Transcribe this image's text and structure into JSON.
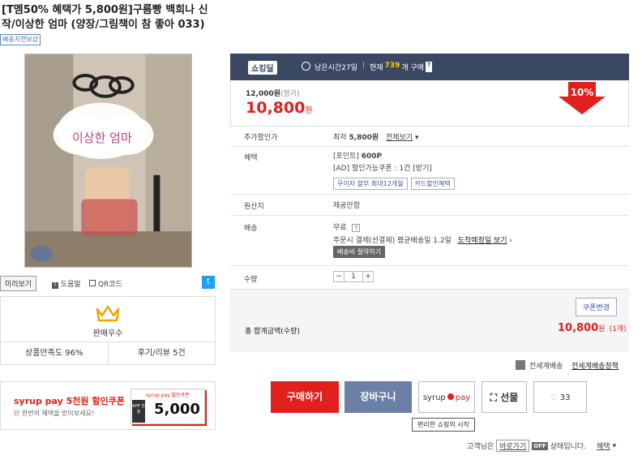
{
  "product": {
    "title": "[T멤50% 혜택가 5,800원]구름빵 백희나 신작/이상한 엄마 (양장/그림책이 참 좋아 033)",
    "badge": "배송지연보상",
    "photo_caption": "이상한 엄마"
  },
  "left_panel": {
    "preview_label": "미리보기",
    "help_label": "도움말",
    "qr_label": "QR코드",
    "seller_grade": "판매우수",
    "satisfaction": "상품만족도 96%",
    "reviews": "후기/리뷰 5건"
  },
  "ad": {
    "headline": "syrup pay 5천원 할인쿠폰",
    "sub": "단 한번의 혜택을 받아보세요!",
    "card_brand": "syrup pay 할인쿠폰",
    "card_app": "APP 전용",
    "card_amount": "5,000"
  },
  "deal_header": {
    "logo": "쇼킹딜",
    "remaining": "남은시간27일",
    "sep": "|",
    "current_prefix": "현재",
    "count": "739",
    "current_suffix": "개 구매",
    "help": "?"
  },
  "price": {
    "original": "12,000원",
    "original_tag": "(정가)",
    "sale": "10,800",
    "won": "원",
    "discount": "10%"
  },
  "rows": {
    "extra_discount": {
      "label": "추가할인가",
      "prefix": "최저",
      "amount": "5,800원",
      "link": "전체보기"
    },
    "benefit": {
      "label": "혜택",
      "point": "[포인트]",
      "point_val": "600P",
      "coupon": "[AD] 할인가능쿠폰 : 1건 [받기]",
      "installment_btn": "무이자 할부 최대12개월",
      "card_btn": "카드할인혜택"
    },
    "origin": {
      "label": "원산지",
      "value": "제공안함"
    },
    "shipping": {
      "label": "배송",
      "free": "무료",
      "help": "?",
      "detail": "주문시 결제(선결제) 평균배송일 1.2일",
      "date_link": "도착예정일 보기",
      "save_btn": "배송비 절약하기"
    },
    "quantity": {
      "label": "수량",
      "minus": "−",
      "value": "1",
      "plus": "+"
    }
  },
  "total": {
    "coupon_btn": "쿠폰변경",
    "label": "총 합계금액(수량)",
    "amount": "10,800",
    "won": "원",
    "qty": "(1개)"
  },
  "delivery_global": {
    "label": "전세계배송",
    "link": "전세계배송정책"
  },
  "buttons": {
    "buy": "구매하기",
    "cart": "장바구니",
    "syrup": "syrup",
    "syrup_pay": "pay",
    "gift": "선물",
    "like_count": "33",
    "tooltip": "편리한 쇼핑의 시작"
  },
  "footer": {
    "prefix": "고객님은",
    "mode": "바로가기",
    "toggle": "OFF",
    "suffix": "상태입니다.",
    "benefit": "혜택"
  },
  "colors": {
    "red": "#e0201c",
    "header": "#3b4864",
    "cart": "#6c7fa6"
  }
}
